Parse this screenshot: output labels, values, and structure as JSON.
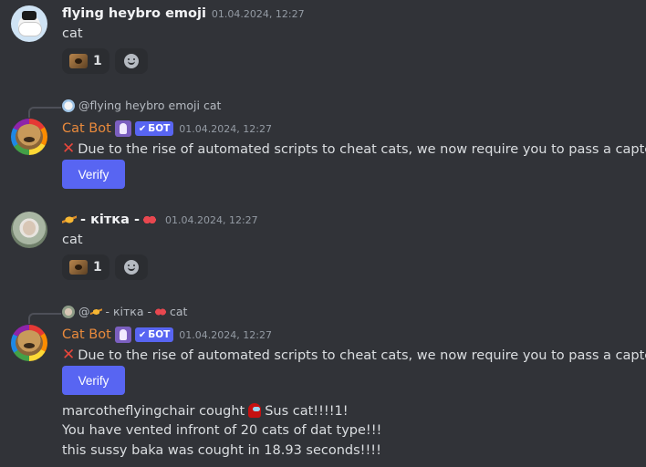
{
  "messages": [
    {
      "author": "flying heybro emoji",
      "time": "01.04.2024, 12:27",
      "text": "cat",
      "reaction": {
        "emoji": "cat-emoji",
        "count": "1"
      }
    },
    {
      "reply": {
        "mention": "@flying heybro emoji",
        "text": "cat"
      },
      "author": "Cat Bot",
      "bot_tag": "БОТ",
      "time": "01.04.2024, 12:27",
      "text": "Due to the rise of automated scripts to cheat cats, we now require you to pass a captcha.",
      "button": "Verify"
    },
    {
      "author_prefix": "- кітка -",
      "time": "01.04.2024, 12:27",
      "text": "cat",
      "reaction": {
        "emoji": "cat-emoji",
        "count": "1"
      }
    },
    {
      "reply": {
        "mention": "@",
        "mention_name": "- кітка -",
        "text": "cat"
      },
      "author": "Cat Bot",
      "bot_tag": "БОТ",
      "time": "01.04.2024, 12:27",
      "text": "Due to the rise of automated scripts to cheat cats, we now require you to pass a captcha.",
      "button": "Verify",
      "extra_line1_a": "marcotheflyingchair cought",
      "extra_line1_b": "Sus cat!!!!1!",
      "extra_line2": "You have vented infront of 20 cats of dat type!!!",
      "extra_line3": "this sussy baka was cought in 18.93 seconds!!!!"
    }
  ],
  "colors": {
    "background": "#313338",
    "blurple": "#5865f2",
    "bot_name": "#e98a3c",
    "cross": "#e8463b"
  }
}
